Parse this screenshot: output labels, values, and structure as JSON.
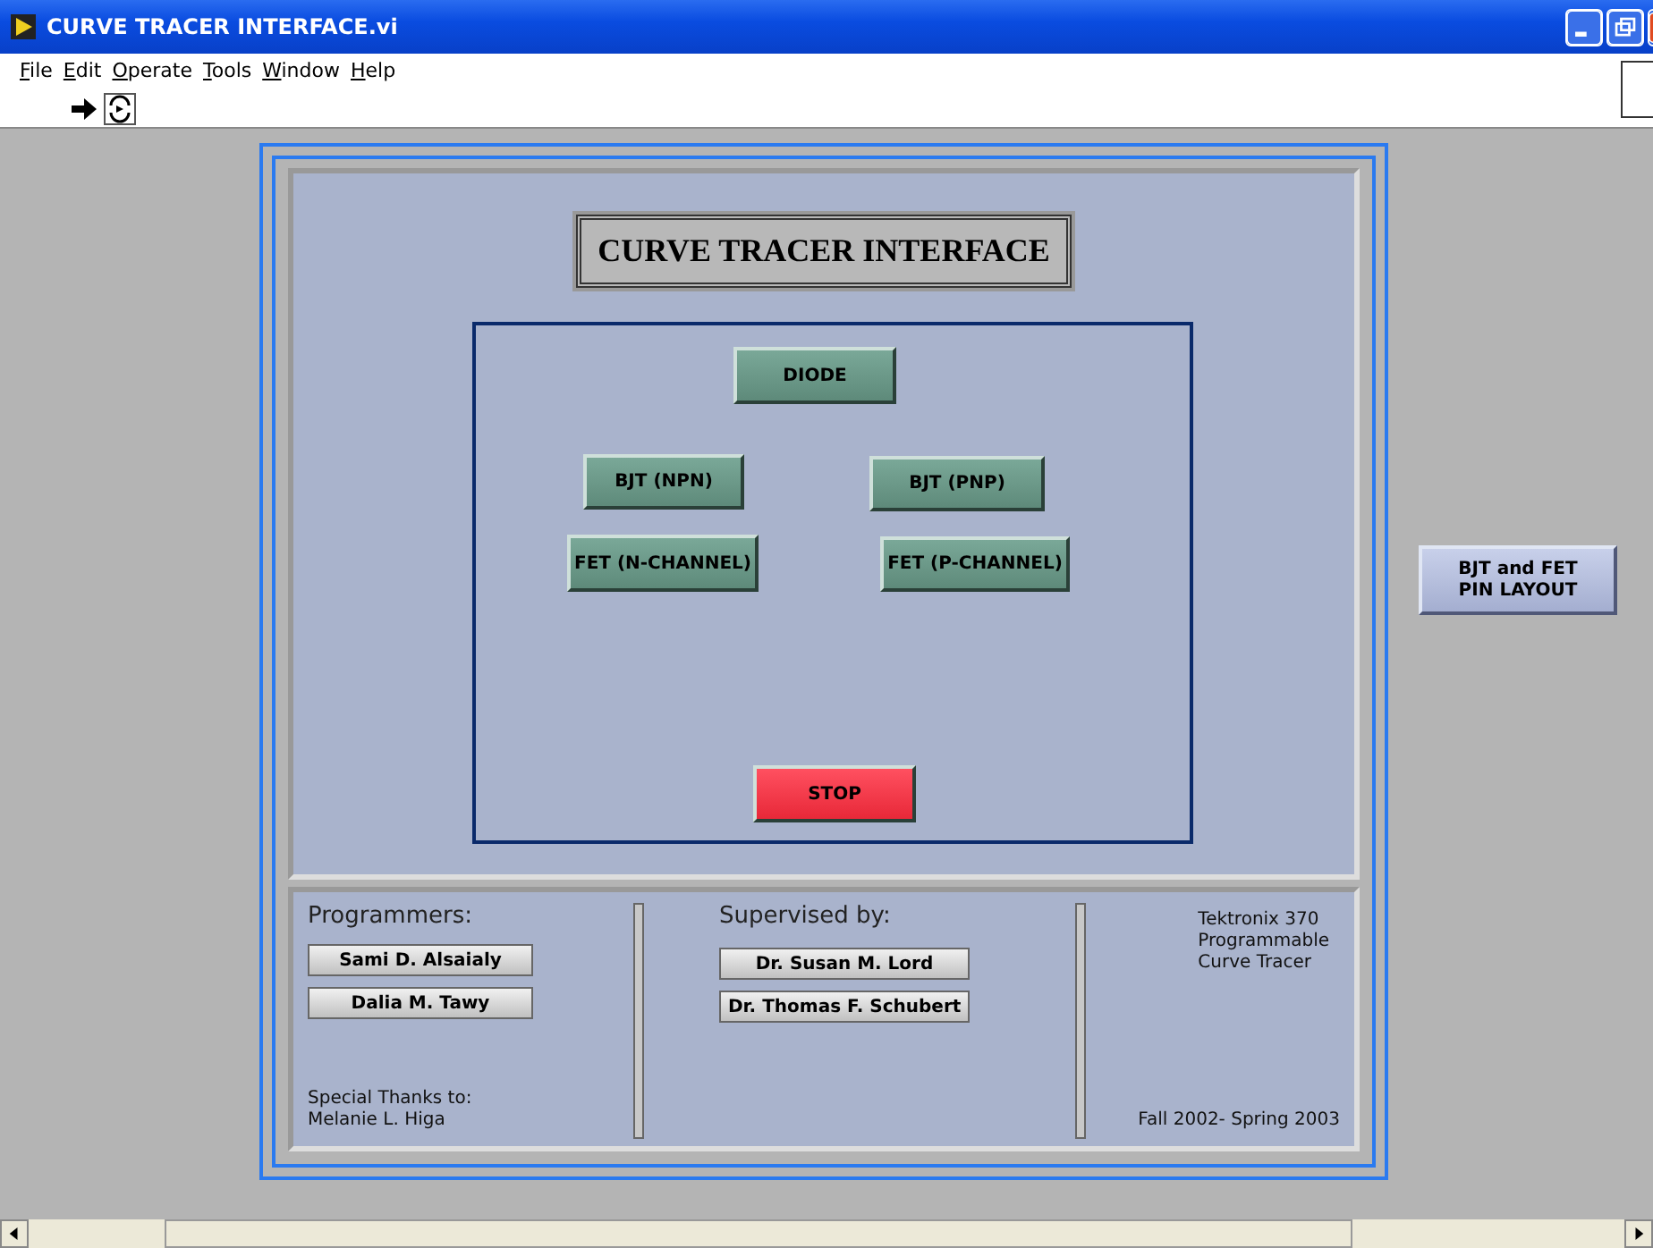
{
  "window": {
    "title": "CURVE TRACER INTERFACE.vi"
  },
  "menu": [
    "File",
    "Edit",
    "Operate",
    "Tools",
    "Window",
    "Help"
  ],
  "panel": {
    "title": "CURVE TRACER INTERFACE",
    "buttons": [
      {
        "label": "DIODE",
        "kind": "mode"
      },
      {
        "label": "BJT (NPN)",
        "kind": "mode"
      },
      {
        "label": "BJT (PNP)",
        "kind": "mode"
      },
      {
        "label": "FET (N-CHANNEL)",
        "kind": "mode"
      },
      {
        "label": "FET (P-CHANNEL)",
        "kind": "mode"
      },
      {
        "label": "STOP",
        "kind": "stop"
      }
    ],
    "credits": {
      "programmers_label": "Programmers:",
      "programmers": [
        "Sami D. Alsaialy",
        "Dalia M. Tawy"
      ],
      "thanks": [
        "Special Thanks to:",
        "Melanie L. Higa"
      ],
      "supervisors_label": "Supervised by:",
      "supervisors": [
        "Dr. Susan M. Lord",
        "Dr. Thomas F.  Schubert"
      ],
      "instrument": [
        "Tektronix 370",
        "Programmable",
        "Curve Tracer"
      ],
      "dates": "Fall 2002- Spring 2003"
    }
  },
  "side_button": [
    "BJT and FET",
    "PIN LAYOUT"
  ]
}
